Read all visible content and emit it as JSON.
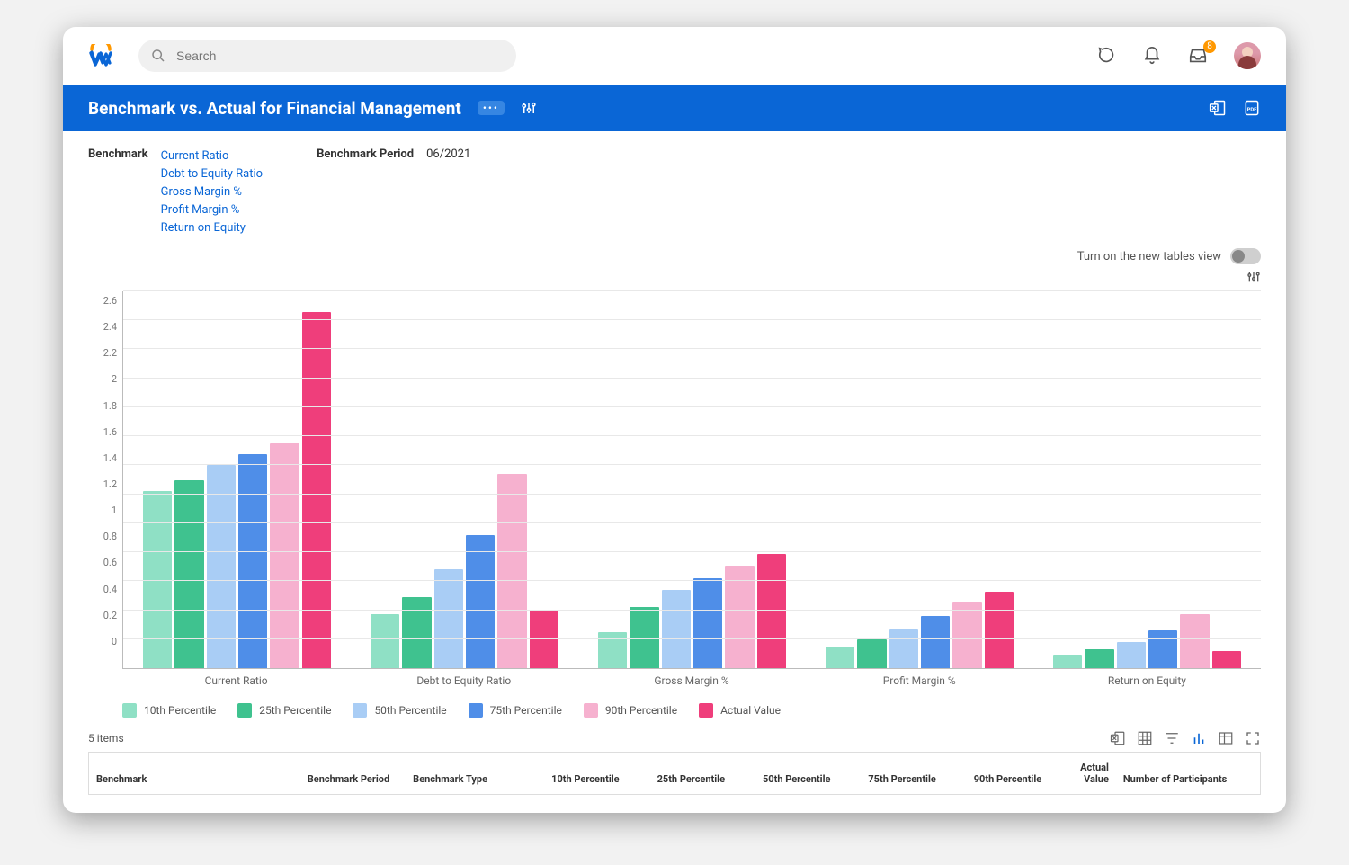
{
  "app": {
    "search_placeholder": "Search",
    "inbox_badge": "8"
  },
  "header": {
    "title": "Benchmark vs. Actual for Financial Management"
  },
  "params": {
    "benchmark_label": "Benchmark",
    "benchmarks": [
      "Current Ratio",
      "Debt to Equity Ratio",
      "Gross Margin %",
      "Profit Margin %",
      "Return on Equity"
    ],
    "period_label": "Benchmark Period",
    "period_value": "06/2021"
  },
  "toggle_label": "Turn on the new tables view",
  "table": {
    "items_label": "5 items",
    "columns": [
      "Benchmark",
      "Benchmark Period",
      "Benchmark Type",
      "10th Percentile",
      "25th Percentile",
      "50th Percentile",
      "75th Percentile",
      "90th Percentile",
      "Actual Value",
      "Number of Participants"
    ]
  },
  "chart_data": {
    "type": "bar",
    "title": "",
    "xlabel": "",
    "ylabel": "",
    "ylim": [
      0,
      2.6
    ],
    "y_ticks": [
      0,
      0.2,
      0.4,
      0.6,
      0.8,
      1,
      1.2,
      1.4,
      1.6,
      1.8,
      2,
      2.2,
      2.4,
      2.6
    ],
    "categories": [
      "Current Ratio",
      "Debt to Equity Ratio",
      "Gross Margin %",
      "Profit Margin %",
      "Return on Equity"
    ],
    "series": [
      {
        "name": "10th Percentile",
        "color": "#8fe0c5",
        "values": [
          1.22,
          0.37,
          0.25,
          0.15,
          0.09
        ]
      },
      {
        "name": "25th Percentile",
        "color": "#3fc28f",
        "values": [
          1.3,
          0.49,
          0.42,
          0.2,
          0.13
        ]
      },
      {
        "name": "50th Percentile",
        "color": "#a9cdf5",
        "values": [
          1.4,
          0.68,
          0.54,
          0.27,
          0.18
        ]
      },
      {
        "name": "75th Percentile",
        "color": "#4f8ee8",
        "values": [
          1.48,
          0.92,
          0.62,
          0.36,
          0.26
        ]
      },
      {
        "name": "90th Percentile",
        "color": "#f6b1cf",
        "values": [
          1.55,
          1.34,
          0.7,
          0.45,
          0.37
        ]
      },
      {
        "name": "Actual Value",
        "color": "#ef3e7b",
        "values": [
          2.46,
          0.4,
          0.79,
          0.53,
          0.12
        ]
      }
    ]
  }
}
